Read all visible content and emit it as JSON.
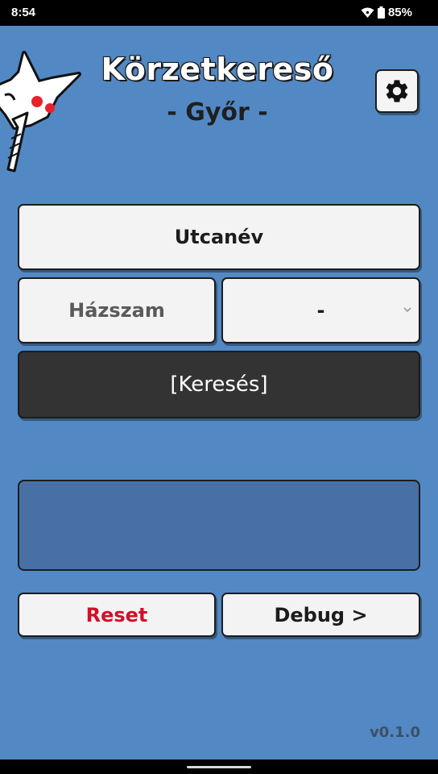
{
  "status_bar": {
    "time": "8:54",
    "battery": "85%",
    "icons": [
      "wifi-icon",
      "battery-icon"
    ]
  },
  "header": {
    "title": "Körzetkereső",
    "subtitle": "- Győr -",
    "settings_icon": "gear-icon"
  },
  "form": {
    "street_label": "Utcanév",
    "house_number_placeholder": "Házszam",
    "letter_value": "-",
    "search_label": "[Keresés]"
  },
  "actions": {
    "reset_label": "Reset",
    "debug_label": "Debug >"
  },
  "footer": {
    "version": "v0.1.0"
  },
  "colors": {
    "background": "#5289c4",
    "result_panel": "#4870a6",
    "search_button": "#333333",
    "reset_text": "#d0102a"
  }
}
